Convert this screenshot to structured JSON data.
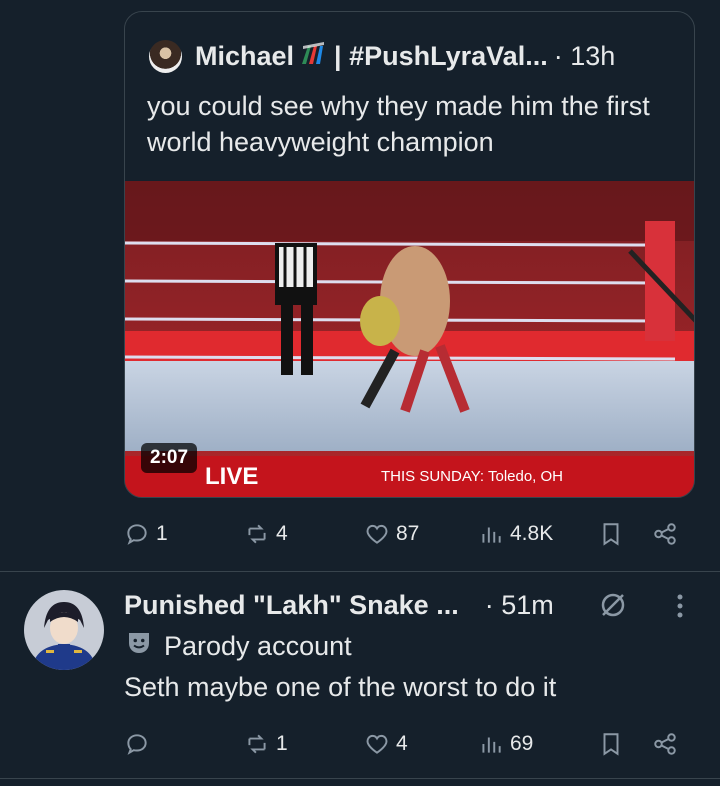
{
  "quote": {
    "author_name": "Michael",
    "handle_text": "| #PushLyraVal...",
    "time": "· 13h",
    "text": "you could see why they made him the first world heavyweight champion",
    "video": {
      "duration": "2:07",
      "banner_live": "LIVE",
      "banner_info": "THIS SUNDAY: Toledo, OH"
    }
  },
  "quote_actions": {
    "replies": "1",
    "reposts": "4",
    "likes": "87",
    "views": "4.8K"
  },
  "reply": {
    "author_name": "Punished \"Lakh\" Snake ...",
    "time": "· 51m",
    "label": "Parody account",
    "text": "Seth maybe one of the worst to do it"
  },
  "reply_actions": {
    "replies": "",
    "reposts": "1",
    "likes": "4",
    "views": "69"
  },
  "colors": {
    "background": "#15202b",
    "text": "#e7e9ea",
    "muted": "#8b98a5",
    "border": "#38444d"
  }
}
